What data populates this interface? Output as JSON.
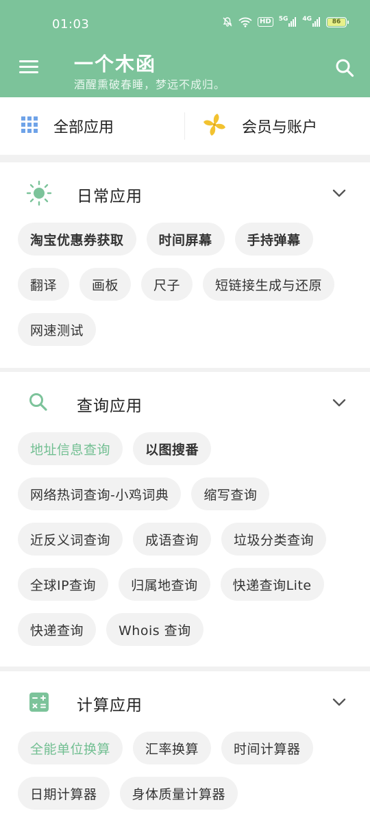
{
  "status_bar": {
    "time": "01:03",
    "icons": [
      "bell-off-icon",
      "wifi-icon",
      "hd-icon",
      "5g-signal-icon",
      "4g-signal-icon",
      "battery-icon"
    ],
    "hd_label": "HD",
    "signal_5g": "5G",
    "signal_4g": "4G",
    "battery": "86"
  },
  "header": {
    "title": "一个木函",
    "subtitle": "酒醒熏破春睡，梦远不成归。",
    "icons": [
      "menu-icon",
      "search-icon"
    ]
  },
  "quick_nav": {
    "all_apps": "全部应用",
    "membership": "会员与账户"
  },
  "colors": {
    "primary": "#7cc39a",
    "active_text": "#72bf92",
    "chip_bg": "#f2f2f2"
  },
  "sections": [
    {
      "title": "日常应用",
      "icon": "sun-icon",
      "items": [
        {
          "label": "淘宝优惠券获取",
          "bold": true
        },
        {
          "label": "时间屏幕",
          "bold": true
        },
        {
          "label": "手持弹幕",
          "bold": true
        },
        {
          "label": "翻译"
        },
        {
          "label": "画板"
        },
        {
          "label": "尺子"
        },
        {
          "label": "短链接生成与还原"
        },
        {
          "label": "网速测试"
        }
      ]
    },
    {
      "title": "查询应用",
      "icon": "search-icon",
      "items": [
        {
          "label": "地址信息查询",
          "active": true
        },
        {
          "label": "以图搜番",
          "bold": true
        },
        {
          "label": "网络热词查询-小鸡词典"
        },
        {
          "label": "缩写查询"
        },
        {
          "label": "近反义词查询"
        },
        {
          "label": "成语查询"
        },
        {
          "label": "垃圾分类查询"
        },
        {
          "label": "全球IP查询"
        },
        {
          "label": "归属地查询"
        },
        {
          "label": "快递查询Lite"
        },
        {
          "label": "快递查询"
        },
        {
          "label": "Whois 查询"
        }
      ]
    },
    {
      "title": "计算应用",
      "icon": "calculator-icon",
      "items": [
        {
          "label": "全能单位换算",
          "active": true
        },
        {
          "label": "汇率换算"
        },
        {
          "label": "时间计算器"
        },
        {
          "label": "日期计算器"
        },
        {
          "label": "身体质量计算器"
        }
      ]
    }
  ]
}
